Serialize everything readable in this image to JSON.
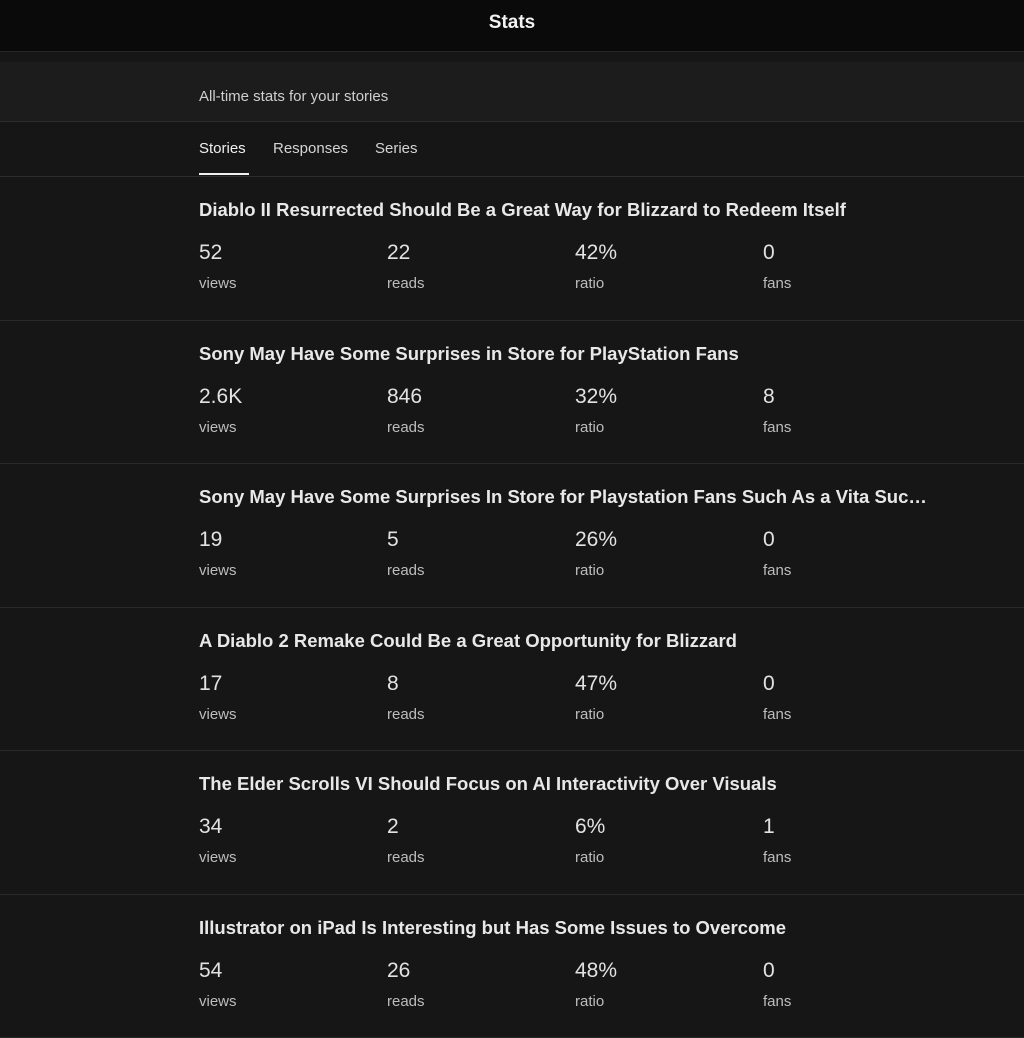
{
  "header": {
    "title": "Stats"
  },
  "subheader": {
    "text": "All-time stats for your stories"
  },
  "tabs": [
    {
      "label": "Stories",
      "active": true
    },
    {
      "label": "Responses",
      "active": false
    },
    {
      "label": "Series",
      "active": false
    }
  ],
  "labels": {
    "views": "views",
    "reads": "reads",
    "ratio": "ratio",
    "fans": "fans"
  },
  "stories": [
    {
      "title": "Diablo II Resurrected Should Be a Great Way for Blizzard to Redeem Itself",
      "views": "52",
      "reads": "22",
      "ratio": "42%",
      "fans": "0"
    },
    {
      "title": "Sony May Have Some Surprises in Store for PlayStation Fans",
      "views": "2.6K",
      "reads": "846",
      "ratio": "32%",
      "fans": "8"
    },
    {
      "title": "Sony May Have Some Surprises In Store for Playstation Fans Such As a Vita Suc…",
      "views": "19",
      "reads": "5",
      "ratio": "26%",
      "fans": "0"
    },
    {
      "title": "A Diablo 2 Remake Could Be a Great Opportunity for Blizzard",
      "views": "17",
      "reads": "8",
      "ratio": "47%",
      "fans": "0"
    },
    {
      "title": "The Elder Scrolls VI Should Focus on AI Interactivity Over Visuals",
      "views": "34",
      "reads": "2",
      "ratio": "6%",
      "fans": "1"
    },
    {
      "title": "Illustrator on iPad Is Interesting but Has Some Issues to Overcome",
      "views": "54",
      "reads": "26",
      "ratio": "48%",
      "fans": "0"
    }
  ]
}
